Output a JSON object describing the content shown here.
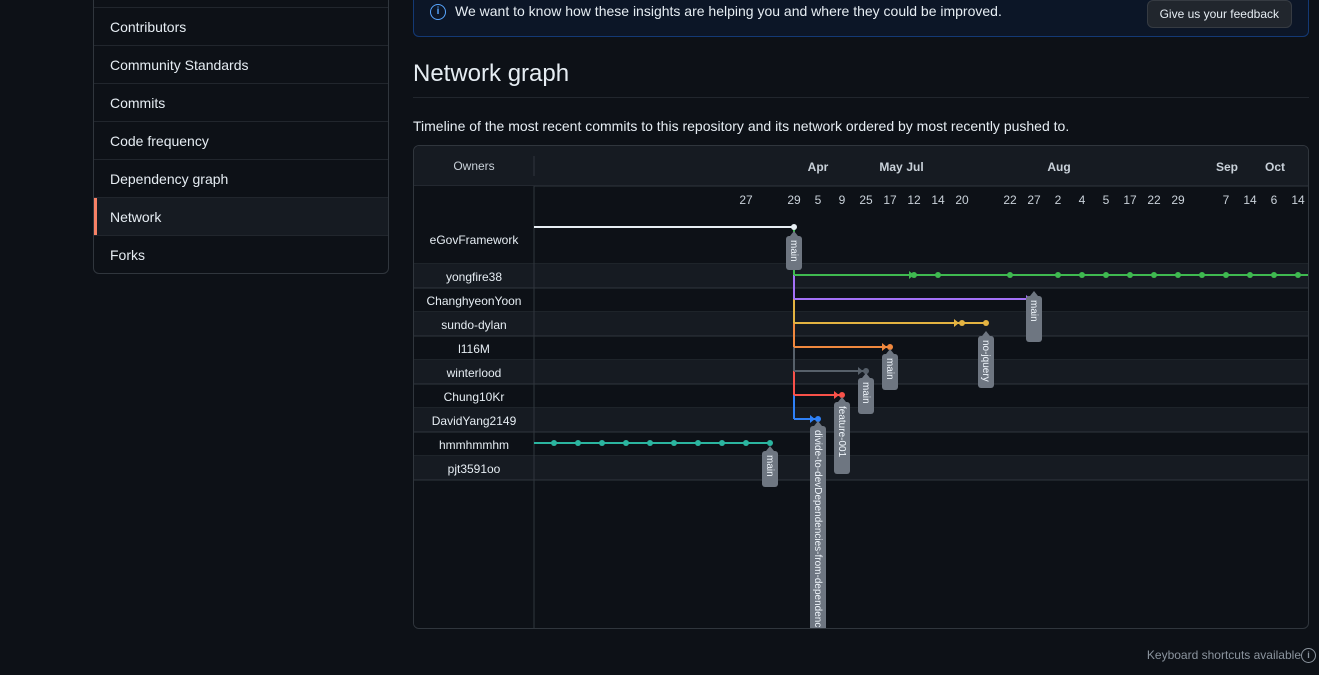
{
  "sidebar": {
    "items": [
      {
        "label": "Contributors",
        "selected": false
      },
      {
        "label": "Community Standards",
        "selected": false
      },
      {
        "label": "Commits",
        "selected": false
      },
      {
        "label": "Code frequency",
        "selected": false
      },
      {
        "label": "Dependency graph",
        "selected": false
      },
      {
        "label": "Network",
        "selected": true
      },
      {
        "label": "Forks",
        "selected": false
      }
    ]
  },
  "banner": {
    "text": "We want to know how these insights are helping you and where they could be improved.",
    "button_label": "Give us your feedback"
  },
  "page": {
    "title": "Network graph",
    "description": "Timeline of the most recent commits to this repository and its network ordered by most recently pushed to."
  },
  "graph": {
    "owners_header": "Owners",
    "months": [
      "Apr",
      "May",
      "Jul",
      "Aug",
      "Sep",
      "Oct"
    ],
    "days": [
      "27",
      "29",
      "5",
      "9",
      "25",
      "17",
      "12",
      "14",
      "20",
      "22",
      "27",
      "2",
      "4",
      "5",
      "17",
      "22",
      "29",
      "7",
      "14",
      "6",
      "14"
    ],
    "owners": [
      "eGovFramework",
      "yongfire38",
      "ChanghyeonYoon",
      "sundo-dylan",
      "l116M",
      "winterlood",
      "Chung10Kr",
      "DavidYang2149",
      "hmmhmmhm",
      "pjt3591oo"
    ],
    "branch_labels": [
      "main",
      "main",
      "no-jquery",
      "main",
      "main",
      "feature-001",
      "divide-to-devDependencies-from-dependencies",
      "main"
    ],
    "colors": {
      "white": "#e6edf3",
      "green": "#3fb950",
      "purple": "#a371f7",
      "yellow": "#e3b341",
      "orange": "#f0883e",
      "slate": "#57606a",
      "red": "#f85149",
      "blue": "#2f81f7",
      "teal": "#2bb5a0"
    }
  },
  "footer": {
    "keyboard_shortcuts": "Keyboard shortcuts available"
  }
}
